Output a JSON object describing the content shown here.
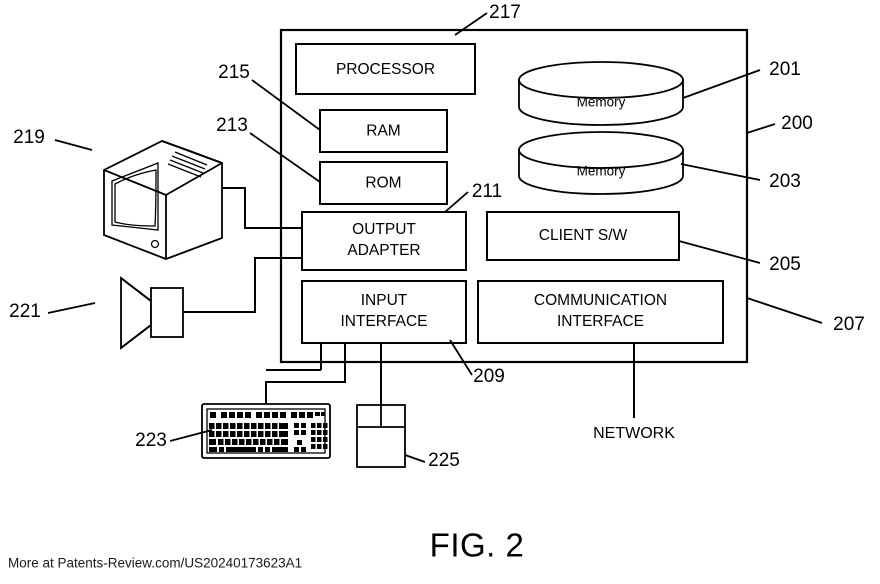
{
  "figure": {
    "caption": "FIG. 2",
    "footer": "More at Patents-Review.com/US20240173623A1"
  },
  "blocks": {
    "processor": "PROCESSOR",
    "ram": "RAM",
    "rom": "ROM",
    "output_adapter_line1": "OUTPUT",
    "output_adapter_line2": "ADAPTER",
    "input_interface_line1": "INPUT",
    "input_interface_line2": "INTERFACE",
    "client_sw": "CLIENT S/W",
    "comm_interface_line1": "COMMUNICATION",
    "comm_interface_line2": "INTERFACE",
    "memory_top": "Memory",
    "memory_bottom": "Memory",
    "network": "NETWORK"
  },
  "reference_numbers": {
    "n200": "200",
    "n201": "201",
    "n203": "203",
    "n205": "205",
    "n207": "207",
    "n209": "209",
    "n211": "211",
    "n213": "213",
    "n215": "215",
    "n217": "217",
    "n219": "219",
    "n221": "221",
    "n223": "223",
    "n225": "225"
  },
  "devices": {
    "monitor": "monitor",
    "speaker": "speaker",
    "keyboard": "keyboard",
    "mouse": "mouse"
  },
  "colors": {
    "stroke": "#000000",
    "fill": "#ffffff",
    "background": "#ffffff"
  }
}
